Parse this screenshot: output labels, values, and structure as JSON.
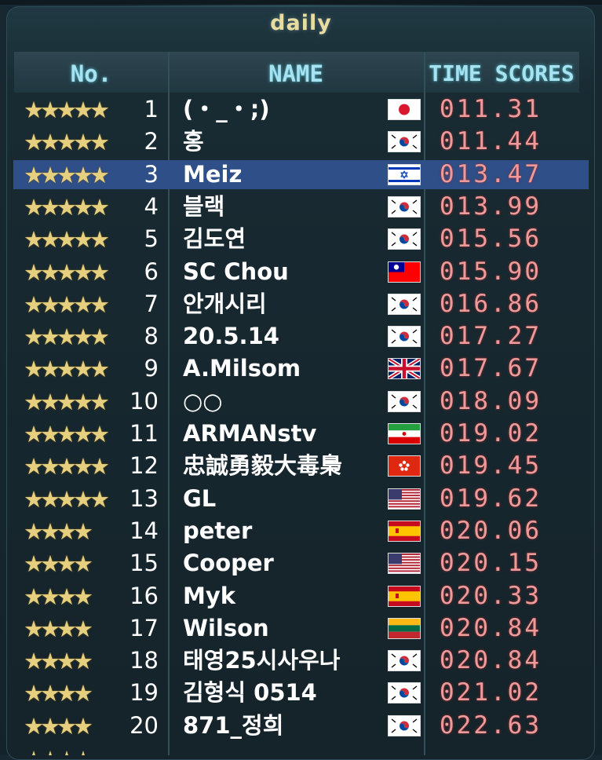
{
  "title": "daily",
  "headers": {
    "no": "No.",
    "name": "NAME",
    "score": "TIME SCORES"
  },
  "colors": {
    "title": "#e9dca0",
    "header_text": "#a6e2ef",
    "star": "#e6cf7e",
    "score": "#ef9a9a",
    "highlight": "#2f4f88"
  },
  "rows": [
    {
      "stars": "★★★★★",
      "rank": "1",
      "name": "(・_・;)",
      "flag": "japan",
      "score": "011.31",
      "selected": false
    },
    {
      "stars": "★★★★★",
      "rank": "2",
      "name": "홍",
      "flag": "south-korea",
      "score": "011.44",
      "selected": false
    },
    {
      "stars": "★★★★★",
      "rank": "3",
      "name": "Meiz",
      "flag": "israel",
      "score": "013.47",
      "selected": true
    },
    {
      "stars": "★★★★★",
      "rank": "4",
      "name": "블랙",
      "flag": "south-korea",
      "score": "013.99",
      "selected": false
    },
    {
      "stars": "★★★★★",
      "rank": "5",
      "name": "김도연",
      "flag": "south-korea",
      "score": "015.56",
      "selected": false
    },
    {
      "stars": "★★★★★",
      "rank": "6",
      "name": "SC Chou",
      "flag": "taiwan",
      "score": "015.90",
      "selected": false
    },
    {
      "stars": "★★★★★",
      "rank": "7",
      "name": "안개시리",
      "flag": "south-korea",
      "score": "016.86",
      "selected": false
    },
    {
      "stars": "★★★★★",
      "rank": "8",
      "name": "20.5.14",
      "flag": "south-korea",
      "score": "017.27",
      "selected": false
    },
    {
      "stars": "★★★★★",
      "rank": "9",
      "name": "A.Milsom",
      "flag": "united-kingdom",
      "score": "017.67",
      "selected": false
    },
    {
      "stars": "★★★★★",
      "rank": "10",
      "name": "○○",
      "flag": "south-korea",
      "score": "018.09",
      "selected": false
    },
    {
      "stars": "★★★★★",
      "rank": "11",
      "name": "ARMANstv",
      "flag": "iran",
      "score": "019.02",
      "selected": false
    },
    {
      "stars": "★★★★★",
      "rank": "12",
      "name": "忠誠勇毅大毒梟",
      "flag": "hong-kong",
      "score": "019.45",
      "selected": false
    },
    {
      "stars": "★★★★★",
      "rank": "13",
      "name": "GL",
      "flag": "united-states",
      "score": "019.62",
      "selected": false
    },
    {
      "stars": "★★★★",
      "rank": "14",
      "name": "peter",
      "flag": "spain",
      "score": "020.06",
      "selected": false
    },
    {
      "stars": "★★★★",
      "rank": "15",
      "name": "Cooper",
      "flag": "united-states",
      "score": "020.15",
      "selected": false
    },
    {
      "stars": "★★★★",
      "rank": "16",
      "name": "Myk",
      "flag": "spain",
      "score": "020.33",
      "selected": false
    },
    {
      "stars": "★★★★",
      "rank": "17",
      "name": "Wilson",
      "flag": "lithuania",
      "score": "020.84",
      "selected": false
    },
    {
      "stars": "★★★★",
      "rank": "18",
      "name": "태영25시사우나",
      "flag": "south-korea",
      "score": "020.84",
      "selected": false
    },
    {
      "stars": "★★★★",
      "rank": "19",
      "name": "김형식 0514",
      "flag": "south-korea",
      "score": "021.02",
      "selected": false
    },
    {
      "stars": "★★★★",
      "rank": "20",
      "name": "871_정희",
      "flag": "south-korea",
      "score": "022.63",
      "selected": false
    }
  ],
  "partial_row": {
    "stars": "★★★★"
  }
}
